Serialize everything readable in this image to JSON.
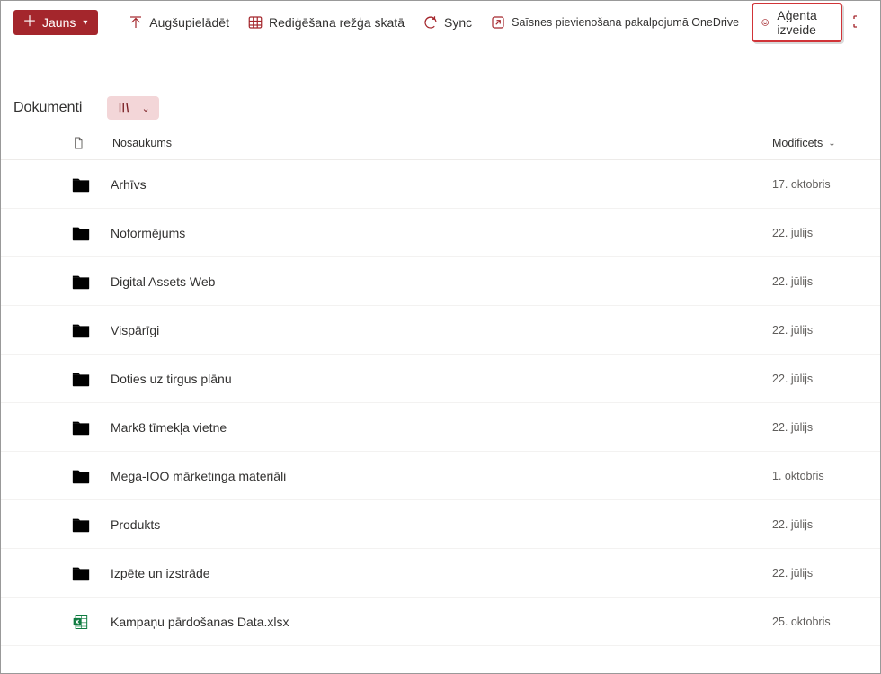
{
  "toolbar": {
    "new_label": "Jauns",
    "upload_label": "Augšupielādēt",
    "grid_label": "Rediģēšana režģa skatā",
    "sync_label": "Sync",
    "shortcut_label": "Saīsnes pievienošana pakalpojumā OneDrive",
    "agent_label": "Aģenta izveide"
  },
  "library": {
    "title": "Dokumenti"
  },
  "columns": {
    "name": "Nosaukums",
    "modified": "Modificēts"
  },
  "items": [
    {
      "name": "Arhīvs",
      "modified": "17. oktobris",
      "type": "folder",
      "color": "gray"
    },
    {
      "name": "Noformējums",
      "modified": "22. jūlijs",
      "type": "folder",
      "color": "yellow"
    },
    {
      "name": "Digital Assets Web",
      "modified": "22. jūlijs",
      "type": "folder",
      "color": "yellow"
    },
    {
      "name": "Vispārīgi",
      "modified": "22. jūlijs",
      "type": "folder",
      "color": "yellow"
    },
    {
      "name": "Doties uz tirgus plānu",
      "modified": "22. jūlijs",
      "type": "folder",
      "color": "yellow"
    },
    {
      "name": "Mark8 tīmekļa vietne",
      "modified": "22. jūlijs",
      "type": "folder",
      "color": "yellow"
    },
    {
      "name": "Mega-IOO mārketinga materiāli",
      "modified": "1. oktobris",
      "type": "folder",
      "color": "magenta"
    },
    {
      "name": "Produkts",
      "modified": "22. jūlijs",
      "type": "folder",
      "color": "yellow"
    },
    {
      "name": "Izpēte un izstrāde",
      "modified": "22. jūlijs",
      "type": "folder",
      "color": "yellow"
    },
    {
      "name": "Kampaņu pārdošanas Data.xlsx",
      "modified": "25. oktobris",
      "type": "excel",
      "color": ""
    }
  ]
}
